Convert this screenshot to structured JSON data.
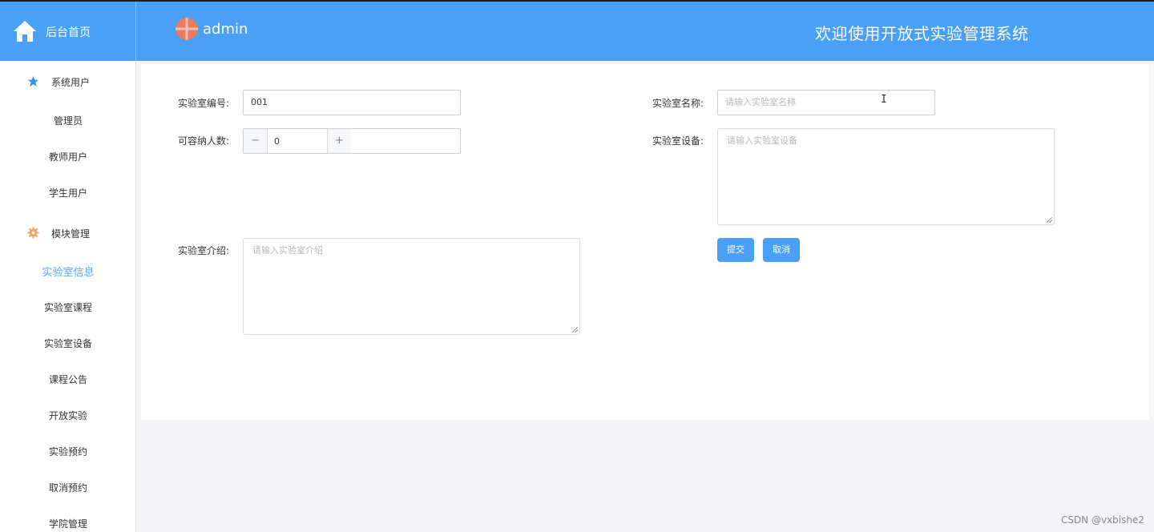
{
  "header": {
    "brand_label": "后台首页",
    "username": "admin",
    "system_title": "欢迎使用开放式实验管理系统",
    "accent_color": "#4aa0f6"
  },
  "sidebar": {
    "groups": [
      {
        "label": "系统用户",
        "icon": "star-icon",
        "items": [
          "管理员",
          "教师用户",
          "学生用户"
        ]
      },
      {
        "label": "模块管理",
        "icon": "gear-icon",
        "items": [
          "实验室信息",
          "实验室课程",
          "实验室设备",
          "课程公告",
          "开放实验",
          "实验预约",
          "取消预约",
          "学院管理"
        ]
      }
    ],
    "active_item": "实验室信息"
  },
  "form": {
    "lab_number": {
      "label": "实验室编号:",
      "value": "001"
    },
    "lab_name": {
      "label": "实验室名称:",
      "placeholder": "请输入实验室名称"
    },
    "capacity": {
      "label": "可容纳人数:",
      "value": "0",
      "minus": "−",
      "plus": "+"
    },
    "equipment": {
      "label": "实验室设备:",
      "placeholder": "请输入实验室设备"
    },
    "intro": {
      "label": "实验室介绍:",
      "placeholder": "请输入实验室介绍"
    },
    "submit_label": "提交",
    "cancel_label": "取消"
  },
  "watermark": "CSDN @vxbishe2"
}
